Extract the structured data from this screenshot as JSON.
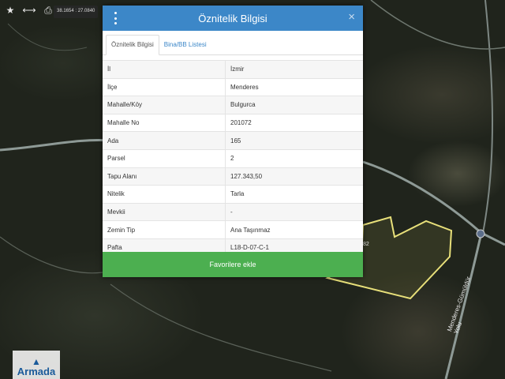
{
  "toolbar": {
    "icons": [
      "star-icon",
      "arrows-horizontal-icon",
      "print-icon"
    ],
    "coordinates": "38.1654 : 27.0840"
  },
  "map": {
    "road_label": "Menderes-Gümüldür Yolu",
    "badge": "82",
    "parcel_outline_color": "#e8e07a"
  },
  "logo": {
    "text": "Armada"
  },
  "panel": {
    "title": "Öznitelik Bilgisi",
    "header_color": "#3c87c8",
    "tabs": [
      {
        "label": "Öznitelik Bilgisi",
        "active": true
      },
      {
        "label": "Bina/BB Listesi",
        "active": false
      }
    ],
    "rows": [
      {
        "key": "İl",
        "value": "İzmir"
      },
      {
        "key": "İlçe",
        "value": "Menderes"
      },
      {
        "key": "Mahalle/Köy",
        "value": "Bulgurca"
      },
      {
        "key": "Mahalle No",
        "value": "201072"
      },
      {
        "key": "Ada",
        "value": "165"
      },
      {
        "key": "Parsel",
        "value": "2"
      },
      {
        "key": "Tapu Alanı",
        "value": "127.343,50"
      },
      {
        "key": "Nitelik",
        "value": "Tarla"
      },
      {
        "key": "Mevkii",
        "value": "-"
      },
      {
        "key": "Zemin Tip",
        "value": "Ana Taşınmaz"
      },
      {
        "key": "Pafta",
        "value": "L18-D-07-C-1"
      }
    ],
    "favorite_button": "Favorilere ekle",
    "button_color": "#4caf50"
  }
}
